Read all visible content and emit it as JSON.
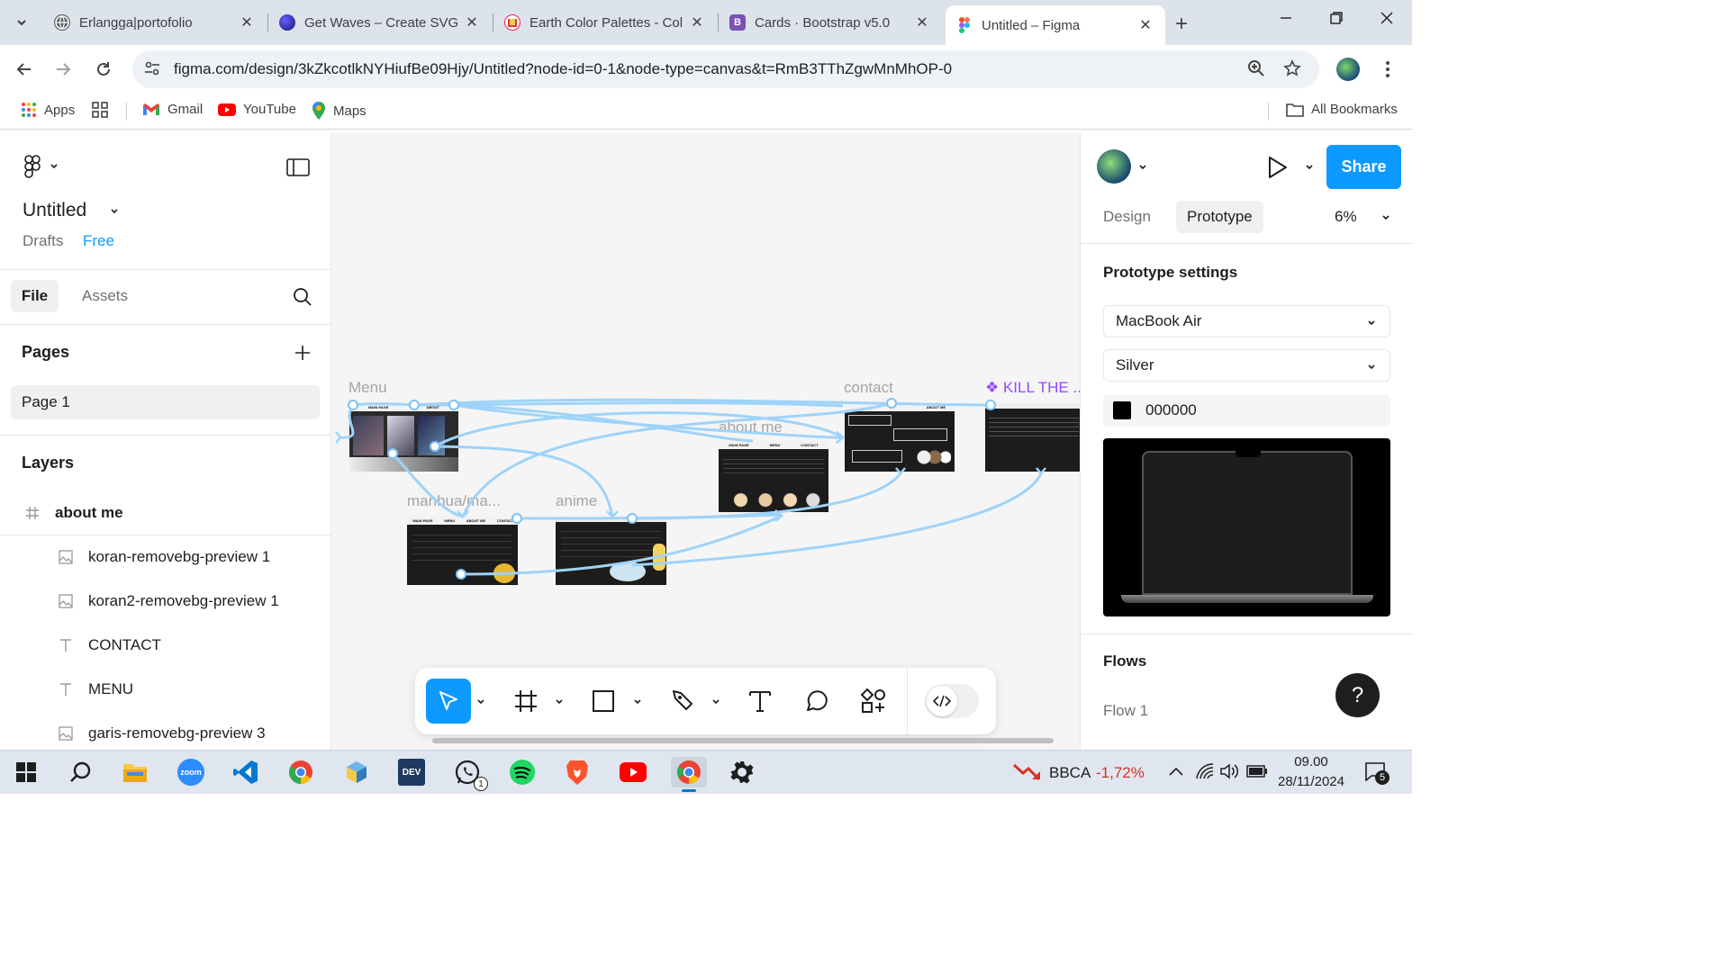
{
  "browser": {
    "tabs": [
      {
        "title": "Erlangga|portofolio",
        "icon": "globe-icon"
      },
      {
        "title": "Get Waves – Create SVG",
        "icon": "waves-icon"
      },
      {
        "title": "Earth Color Palettes - Col",
        "icon": "coolors-icon"
      },
      {
        "title": "Cards · Bootstrap v5.0",
        "icon": "bootstrap-icon",
        "badge": "B"
      },
      {
        "title": "Untitled – Figma",
        "icon": "figma-icon",
        "active": true
      }
    ],
    "url": "figma.com/design/3kZkcotlkNYHiufBe09Hjy/Untitled?node-id=0-1&node-type=canvas&t=RmB3TThZgwMnMhOP-0",
    "bookmarks": {
      "apps": "Apps",
      "gmail": "Gmail",
      "youtube": "YouTube",
      "maps": "Maps",
      "all": "All Bookmarks"
    }
  },
  "figma": {
    "file_title": "Untitled",
    "location": "Drafts",
    "plan": "Free",
    "panel_tabs": {
      "file": "File",
      "assets": "Assets"
    },
    "pages_heading": "Pages",
    "pages": [
      "Page 1"
    ],
    "layers_heading": "Layers",
    "layers": [
      {
        "name": "about me",
        "type": "frame",
        "icon": "frame-hash-icon"
      },
      {
        "name": "koran-removebg-preview 1",
        "type": "image",
        "icon": "image-icon"
      },
      {
        "name": "koran2-removebg-preview 1",
        "type": "image",
        "icon": "image-icon"
      },
      {
        "name": "CONTACT",
        "type": "text",
        "icon": "text-icon"
      },
      {
        "name": "MENU",
        "type": "text",
        "icon": "text-icon"
      },
      {
        "name": "garis-removebg-preview 3",
        "type": "image",
        "icon": "image-icon"
      }
    ],
    "right": {
      "share": "Share",
      "tabs": {
        "design": "Design",
        "prototype": "Prototype"
      },
      "zoom": "6%",
      "prototype_settings": "Prototype settings",
      "device": "MacBook Air",
      "device_color": "Silver",
      "background_hex": "000000",
      "flows_heading": "Flows",
      "flows": [
        "Flow 1"
      ],
      "help": "?"
    },
    "canvas": {
      "frames": [
        {
          "label": "Menu",
          "nav": [
            "MAIN PAGE",
            "ABOUT"
          ]
        },
        {
          "label": "manhua/ma...",
          "nav": [
            "MAIN PAGE",
            "MENU",
            "ABOUT ME",
            "CONTAC"
          ]
        },
        {
          "label": "anime",
          "nav": []
        },
        {
          "label": "about me",
          "nav": [
            "MAIN PAGE",
            "MENU",
            "CONTACT"
          ]
        },
        {
          "label": "contact",
          "nav": [
            "ABOUT ME"
          ]
        },
        {
          "label": "KILL THE ...",
          "nav": []
        }
      ]
    },
    "toolbar": [
      "move-tool",
      "frame-tool",
      "shape-tool",
      "pen-tool",
      "text-tool",
      "comment-tool",
      "actions-tool",
      "dev-mode-toggle"
    ]
  },
  "taskbar": {
    "stock": {
      "ticker": "BBCA",
      "change": "-1,72%"
    },
    "time": "09.00",
    "date": "28/11/2024",
    "whatsapp_badge": "1",
    "notification_count": "5"
  },
  "colors": {
    "accent": "#0d99ff",
    "component_purple": "#9747ff",
    "prototype_line": "#9fd3f9",
    "stock_down": "#d93025"
  }
}
